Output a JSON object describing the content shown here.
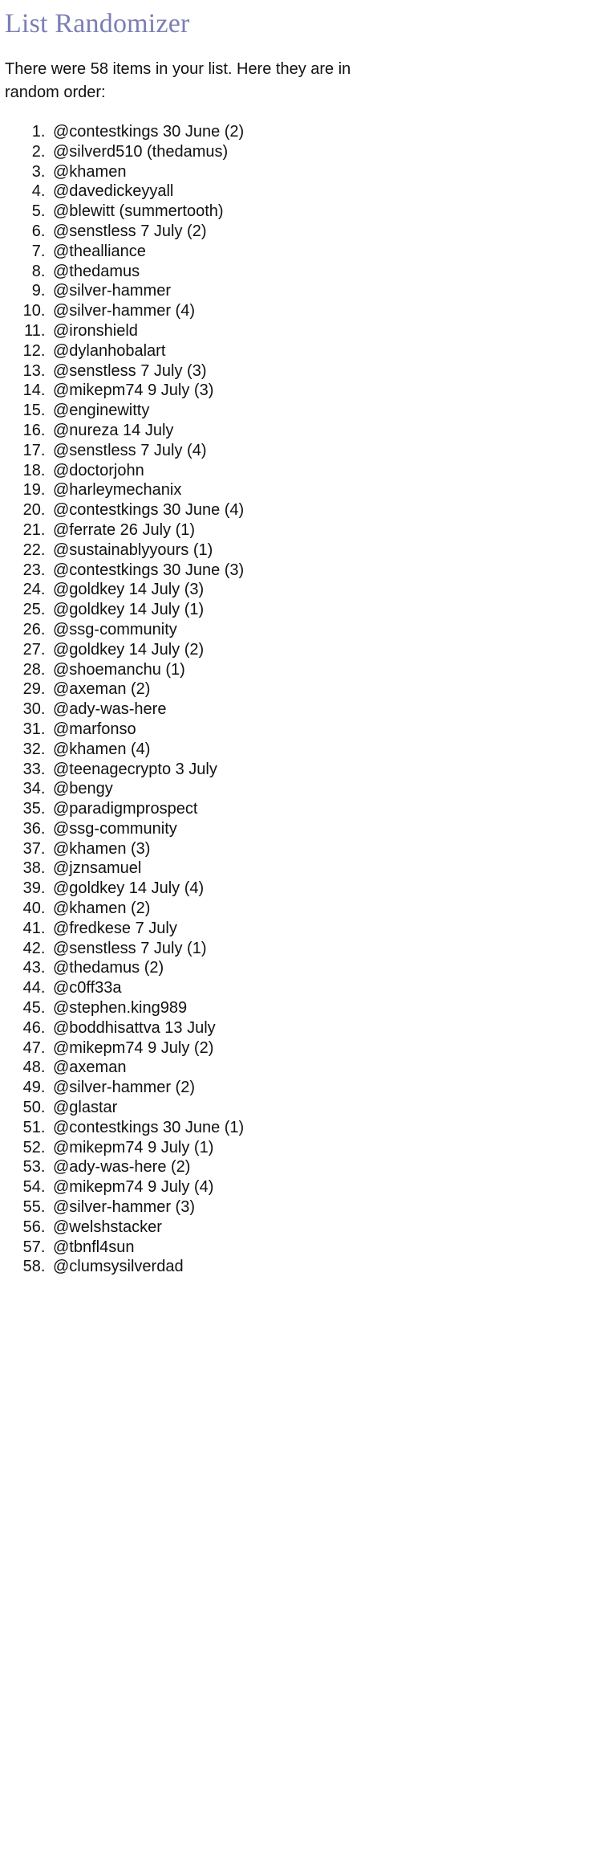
{
  "page": {
    "title": "List Randomizer",
    "intro": "There were 58 items in your list. Here they are in random order:",
    "item_count": 58,
    "title_color": "#7b7fb5",
    "text_color": "#111111",
    "background_color": "#ffffff"
  },
  "list": {
    "items": [
      "@contestkings 30 June (2)",
      "@silverd510 (thedamus)",
      "@khamen",
      "@davedickeyyall",
      "@blewitt (summertooth)",
      "@senstless 7 July (2)",
      "@thealliance",
      "@thedamus",
      "@silver-hammer",
      "@silver-hammer (4)",
      "@ironshield",
      "@dylanhobalart",
      "@senstless 7 July (3)",
      "@mikepm74 9 July (3)",
      "@enginewitty",
      "@nureza 14 July",
      "@senstless 7 July (4)",
      "@doctorjohn",
      "@harleymechanix",
      "@contestkings 30 June (4)",
      "@ferrate 26 July (1)",
      "@sustainablyyours (1)",
      "@contestkings 30 June (3)",
      "@goldkey 14 July (3)",
      "@goldkey 14 July (1)",
      "@ssg-community",
      "@goldkey 14 July (2)",
      "@shoemanchu (1)",
      "@axeman (2)",
      "@ady-was-here",
      "@marfonso",
      "@khamen (4)",
      "@teenagecrypto 3 July",
      "@bengy",
      "@paradigmprospect",
      "@ssg-community",
      "@khamen (3)",
      "@jznsamuel",
      "@goldkey 14 July (4)",
      "@khamen (2)",
      "@fredkese 7 July",
      "@senstless 7 July (1)",
      "@thedamus (2)",
      "@c0ff33a",
      "@stephen.king989",
      "@boddhisattva 13 July",
      "@mikepm74 9 July (2)",
      "@axeman",
      "@silver-hammer (2)",
      "@glastar",
      "@contestkings 30 June (1)",
      "@mikepm74 9 July (1)",
      "@ady-was-here (2)",
      "@mikepm74 9 July (4)",
      "@silver-hammer (3)",
      "@welshstacker",
      "@tbnfl4sun",
      "@clumsysilverdad"
    ]
  }
}
